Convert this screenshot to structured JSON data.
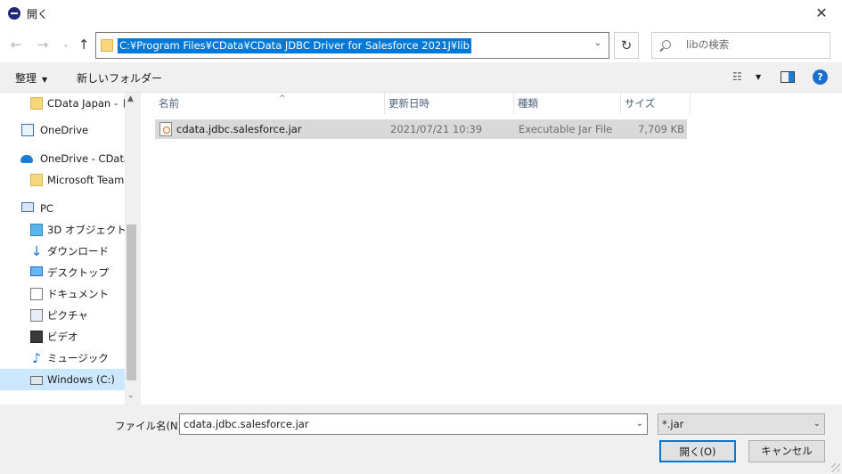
{
  "window": {
    "title": "開く",
    "close_glyph": "✕"
  },
  "navigation": {
    "back_glyph": "←",
    "forward_glyph": "→",
    "recent_glyph": "⌄",
    "up_glyph": "↑",
    "address": "C:¥Program Files¥CData¥CData JDBC Driver for Salesforce 2021J¥lib",
    "address_dropdown_glyph": "⌄",
    "refresh_glyph": "↻",
    "search_placeholder": "libの検索"
  },
  "toolbar": {
    "organize_label": "整理",
    "organize_caret": "▼",
    "new_folder_label": "新しいフォルダー",
    "view_glyph": "☷",
    "view_caret": "▼",
    "help_glyph": "?"
  },
  "nav_pane": {
    "items": [
      {
        "label": "CData Japan - ドキ",
        "icon": "folder-icon"
      },
      {
        "label": "OneDrive",
        "icon": "onedrive-icon"
      },
      {
        "label": "OneDrive - CData",
        "icon": "onedrive-icon"
      },
      {
        "label": "Microsoft Teams",
        "icon": "folder-icon"
      },
      {
        "label": "PC",
        "icon": "pc-icon"
      },
      {
        "label": "3D オブジェクト",
        "icon": "3d-objects-icon"
      },
      {
        "label": "ダウンロード",
        "icon": "download-icon"
      },
      {
        "label": "デスクトップ",
        "icon": "desktop-icon"
      },
      {
        "label": "ドキュメント",
        "icon": "documents-icon"
      },
      {
        "label": "ピクチャ",
        "icon": "pictures-icon"
      },
      {
        "label": "ビデオ",
        "icon": "videos-icon"
      },
      {
        "label": "ミュージック",
        "icon": "music-icon"
      },
      {
        "label": "Windows (C:)",
        "icon": "drive-icon",
        "selected": true
      }
    ],
    "scroll_up_glyph": "▲",
    "scroll_down_glyph": "⌄"
  },
  "file_list": {
    "columns": [
      "名前",
      "更新日時",
      "種類",
      "サイズ"
    ],
    "sort_glyph": "^",
    "rows": [
      {
        "name": "cdata.jdbc.salesforce.jar",
        "modified": "2021/07/21 10:39",
        "type": "Executable Jar File",
        "size": "7,709 KB",
        "icon": "jar-file-icon"
      }
    ]
  },
  "footer": {
    "filename_label": "ファイル名(N):",
    "filename_value": "cdata.jdbc.salesforce.jar",
    "filename_dropdown_glyph": "⌄",
    "filetype_value": "*.jar",
    "filetype_dropdown_glyph": "⌄",
    "open_label": "開く(O)",
    "cancel_label": "キャンセル"
  },
  "colors": {
    "selection": "#0078d7",
    "nav_selected": "#cce8ff",
    "row_selected": "#d9d9d9",
    "help": "#1a6fcf"
  }
}
